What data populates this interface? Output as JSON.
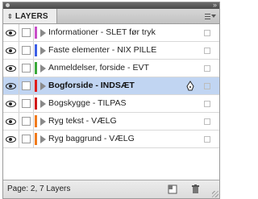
{
  "panel": {
    "tab_label": "LAYERS",
    "menu_icon": "panel-menu-icon",
    "collapse_icon": "double-chevron-icon"
  },
  "layers": [
    {
      "name": "Informationer - SLET før tryk",
      "color": "#c84ec8",
      "visible": true,
      "selected": false
    },
    {
      "name": "Faste elementer - NIX PILLE",
      "color": "#3c5ee6",
      "visible": true,
      "selected": false
    },
    {
      "name": "Anmeldelser, forside - EVT",
      "color": "#3aa83a",
      "visible": true,
      "selected": false
    },
    {
      "name": "Bogforside - INDSÆT",
      "color": "#e01b1b",
      "visible": true,
      "selected": true
    },
    {
      "name": "Bogskygge - TILPAS",
      "color": "#d01818",
      "visible": true,
      "selected": false
    },
    {
      "name": "Ryg tekst - VÆLG",
      "color": "#f07a1c",
      "visible": true,
      "selected": false
    },
    {
      "name": "Ryg baggrund - VÆLG",
      "color": "#f07a1c",
      "visible": true,
      "selected": false
    }
  ],
  "footer": {
    "status": "Page: 2, 7 Layers",
    "new_layer_icon": "new-layer-icon",
    "delete_icon": "trash-icon"
  },
  "colors": {
    "selection": "#c1d5f2",
    "panel_bg": "#ececec"
  }
}
